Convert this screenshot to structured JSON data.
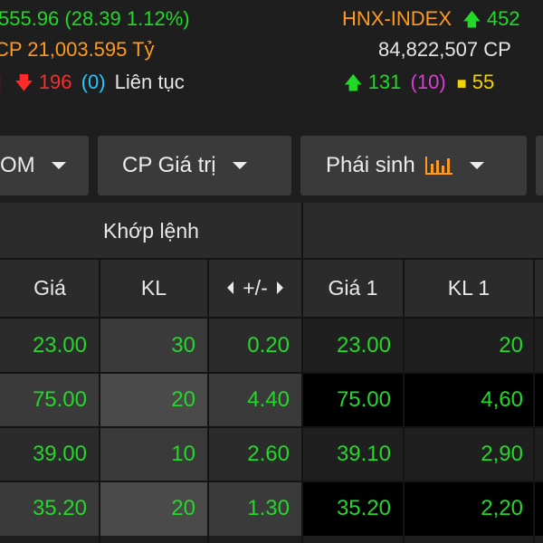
{
  "ticker": {
    "left_index_text": "555.96 (28.39 1.12%)",
    "left_volume_text": "CP 21,003.595 Tỷ",
    "left_down_count": "196",
    "left_unchanged_count": "(0)",
    "left_session_status": "Liên tục",
    "right_index_name": "HNX-INDEX",
    "right_index_value": "452",
    "right_volume_text": "84,822,507 CP",
    "right_up_count": "131",
    "right_ceiling_count": "(10)",
    "right_ref_count": "55",
    "colors": {
      "up": "#21d927",
      "down": "#ff2b2b",
      "floor": "#29c5ff",
      "ceiling": "#e03ad8",
      "reference": "#f2d300",
      "index_name": "#ff9a1f"
    }
  },
  "dropdowns": [
    {
      "label": "OM",
      "icon": "chevron-down-icon"
    },
    {
      "label": "CP Giá trị",
      "icon": "chevron-down-icon"
    },
    {
      "label": "Phái sinh",
      "icon": "bar-chart-icon"
    }
  ],
  "table": {
    "group_header": "Khớp lệnh",
    "columns": {
      "price": "Giá",
      "volume": "KL",
      "change": "+/-",
      "bid_price_1": "Giá 1",
      "bid_volume_1": "KL 1"
    },
    "rows": [
      {
        "price": "23.00",
        "volume": "30",
        "change": "0.20",
        "bid_price_1": "23.00",
        "bid_volume_1": "20"
      },
      {
        "price": "75.00",
        "volume": "20",
        "change": "4.40",
        "bid_price_1": "75.00",
        "bid_volume_1": "4,60"
      },
      {
        "price": "39.00",
        "volume": "10",
        "change": "2.60",
        "bid_price_1": "39.10",
        "bid_volume_1": "2,90"
      },
      {
        "price": "35.20",
        "volume": "20",
        "change": "1.30",
        "bid_price_1": "35.20",
        "bid_volume_1": "2,20"
      }
    ]
  }
}
